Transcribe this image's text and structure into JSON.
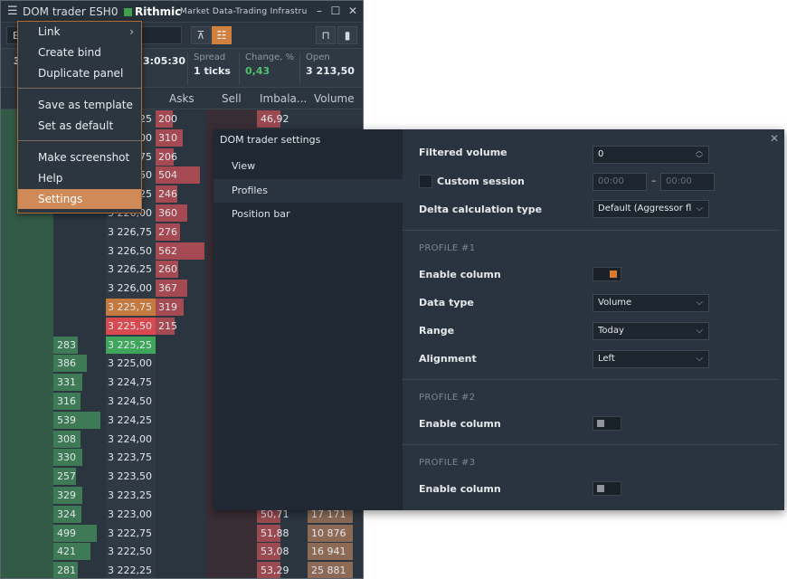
{
  "window": {
    "title": "DOM trader ESH0",
    "brand": "Rithmic",
    "brand_tagline": "Market Data-Trading Infrastructure"
  },
  "toolbar": {
    "symbol": "E",
    "more": "⋮"
  },
  "info": {
    "cells": [
      {
        "label": "",
        "value": "3"
      },
      {
        "label": "",
        "value": "3:05:30"
      },
      {
        "label": "Spread",
        "value": "1 ticks"
      },
      {
        "label": "Change, %",
        "value": "0,43"
      },
      {
        "label": "Open",
        "value": "3 213,50"
      }
    ]
  },
  "columns": [
    "Asks",
    "Sell",
    "Imbala...",
    "Volume"
  ],
  "ladder": {
    "rows": [
      {
        "bid": "",
        "price": "3 227,25",
        "ask": "200",
        "imb": "46,92",
        "vol": ""
      },
      {
        "bid": "",
        "price": "3 227,00",
        "ask": "310",
        "imb": "",
        "vol": ""
      },
      {
        "bid": "",
        "price": "3 226,75",
        "ask": "206",
        "imb": "",
        "vol": ""
      },
      {
        "bid": "",
        "price": "3 226,50",
        "ask": "504",
        "imb": "",
        "vol": ""
      },
      {
        "bid": "",
        "price": "3 226,25",
        "ask": "246",
        "imb": "",
        "vol": ""
      },
      {
        "bid": "",
        "price": "3 226,00",
        "ask": "360",
        "imb": "",
        "vol": ""
      },
      {
        "bid": "",
        "price": "3 226,75",
        "ask": "276",
        "imb": "",
        "vol": ""
      },
      {
        "bid": "",
        "price": "3 226,50",
        "ask": "562",
        "imb": "",
        "vol": ""
      },
      {
        "bid": "",
        "price": "3 226,25",
        "ask": "260",
        "imb": "",
        "vol": ""
      },
      {
        "bid": "",
        "price": "3 226,00",
        "ask": "367",
        "imb": "",
        "vol": ""
      },
      {
        "bid": "",
        "price": "3 225,75",
        "ask": "319",
        "imb": "",
        "vol": "",
        "hl": "orange"
      },
      {
        "bid": "",
        "price": "3 225,50",
        "ask": "215",
        "imb": "",
        "vol": "",
        "hl": "red"
      },
      {
        "bid": "283",
        "price": "3 225,25",
        "ask": "",
        "imb": "",
        "vol": "",
        "hl": "green"
      },
      {
        "bid": "386",
        "price": "3 225,00",
        "ask": "",
        "imb": "",
        "vol": ""
      },
      {
        "bid": "331",
        "price": "3 224,75",
        "ask": "",
        "imb": "",
        "vol": ""
      },
      {
        "bid": "316",
        "price": "3 224,50",
        "ask": "",
        "imb": "",
        "vol": ""
      },
      {
        "bid": "539",
        "price": "3 224,25",
        "ask": "",
        "imb": "",
        "vol": ""
      },
      {
        "bid": "308",
        "price": "3 224,00",
        "ask": "",
        "imb": "",
        "vol": ""
      },
      {
        "bid": "330",
        "price": "3 223,75",
        "ask": "",
        "imb": "",
        "vol": ""
      },
      {
        "bid": "257",
        "price": "3 223,50",
        "ask": "",
        "imb": "",
        "vol": ""
      },
      {
        "bid": "329",
        "price": "3 223,25",
        "ask": "",
        "imb": "",
        "vol": ""
      },
      {
        "bid": "324",
        "price": "3 223,00",
        "ask": "",
        "imb": "50,71",
        "vol": "17 171"
      },
      {
        "bid": "499",
        "price": "3 222,75",
        "ask": "",
        "imb": "51,88",
        "vol": "10 876"
      },
      {
        "bid": "421",
        "price": "3 222,50",
        "ask": "",
        "imb": "53,08",
        "vol": "16 941"
      },
      {
        "bid": "281",
        "price": "3 222,25",
        "ask": "",
        "imb": "53,29",
        "vol": "25 881"
      }
    ]
  },
  "menu": {
    "items": [
      {
        "label": "Link",
        "submenu": "›"
      },
      {
        "label": "Create bind"
      },
      {
        "label": "Duplicate panel"
      },
      {
        "label": "Save as template"
      },
      {
        "label": "Set as default"
      },
      {
        "label": "Make screenshot"
      },
      {
        "label": "Help"
      },
      {
        "label": "Settings",
        "active": true
      }
    ]
  },
  "settings": {
    "title": "DOM trader settings",
    "nav": [
      "View",
      "Profiles",
      "Position bar"
    ],
    "selected_nav": "Profiles",
    "filtered_volume": {
      "label": "Filtered volume",
      "value": "0"
    },
    "custom_session": {
      "label": "Custom session",
      "from": "00:00",
      "dash": "–",
      "to": "00:00",
      "checked": false
    },
    "delta_calc": {
      "label": "Delta calculation type",
      "value": "Default (Aggressor flag)"
    },
    "profile1": {
      "heading": "PROFILE #1",
      "enable": {
        "label": "Enable column",
        "on": true
      },
      "data_type": {
        "label": "Data type",
        "value": "Volume"
      },
      "range": {
        "label": "Range",
        "value": "Today"
      },
      "alignment": {
        "label": "Alignment",
        "value": "Left"
      }
    },
    "profile2": {
      "heading": "PROFILE #2",
      "enable": {
        "label": "Enable column",
        "on": false
      }
    },
    "profile3": {
      "heading": "PROFILE #3",
      "enable": {
        "label": "Enable column",
        "on": false
      }
    }
  },
  "colors": {
    "accent": "#d0803f",
    "bid_bar": "#3d7a55",
    "ask_bar": "#a54a52",
    "green_hl": "#3fa55b",
    "red_hl": "#d84a4f",
    "orange_hl": "#c47a3f"
  }
}
